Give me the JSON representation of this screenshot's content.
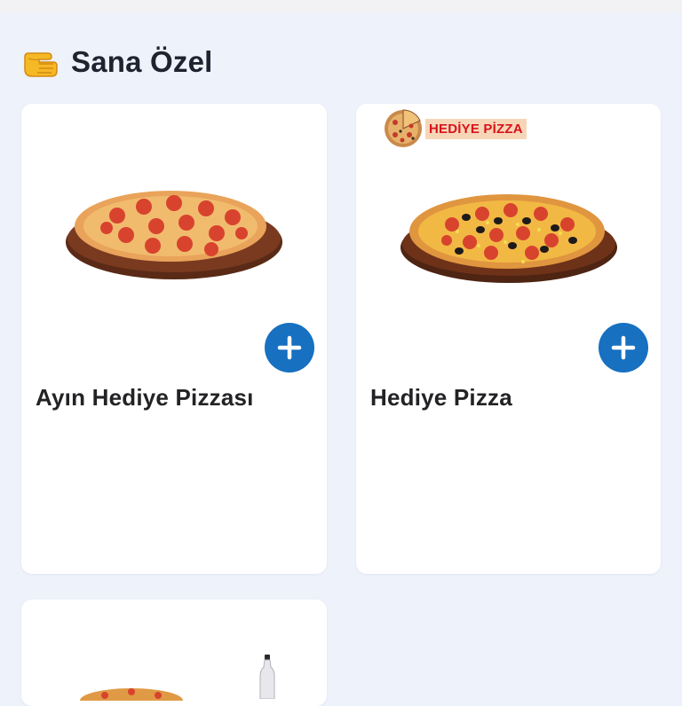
{
  "section": {
    "title": "Sana Özel",
    "icon": "pointing-hand-emoji-icon"
  },
  "products": [
    {
      "name": "Ayın Hediye Pizzası",
      "image": "pepperoni-pizza-image",
      "add_icon": "plus-icon"
    },
    {
      "name": "Hediye Pizza",
      "image": "mixed-pizza-image",
      "add_icon": "plus-icon",
      "badge": {
        "text": "HEDİYE PİZZA",
        "icon": "pizza-slice-logo-icon"
      }
    },
    {
      "name": "",
      "image": "pizza-and-soda-image"
    }
  ],
  "colors": {
    "background": "#eef2fb",
    "card": "#ffffff",
    "accent": "#1770c0",
    "badge_bg": "#f7d6b8",
    "badge_text": "#d7141b"
  }
}
